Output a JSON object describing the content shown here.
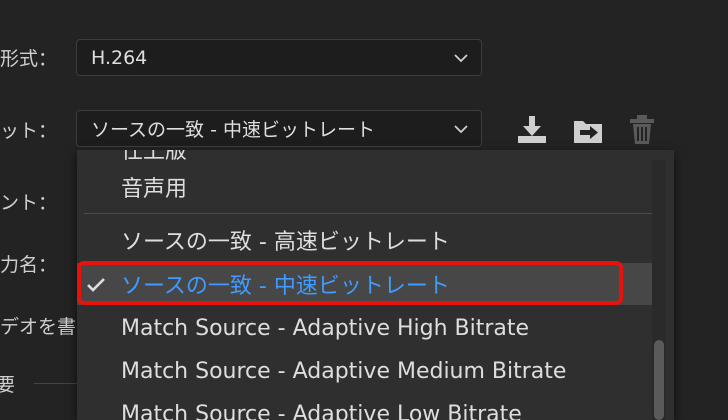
{
  "form": {
    "format": {
      "label": "形式：",
      "value": "H.264"
    },
    "preset": {
      "label": "ット：",
      "value": "ソースの一致 - 中速ビットレート"
    },
    "comment": {
      "label": "ント："
    },
    "output_name": {
      "label": "力名："
    },
    "video_export": {
      "label": "デオを書き"
    },
    "summary": {
      "label": "要"
    }
  },
  "preset_toolbar": {
    "icons": [
      "save-preset-icon",
      "import-preset-icon",
      "delete-preset-icon"
    ]
  },
  "dropdown": {
    "items": [
      {
        "label": "仕上版"
      },
      {
        "label": "音声用"
      },
      {
        "label": "ソースの一致 - 高速ビットレート"
      },
      {
        "label": "ソースの一致 - 中速ビットレート",
        "selected": true
      },
      {
        "label": "Match Source - Adaptive High Bitrate"
      },
      {
        "label": "Match Source - Adaptive Medium Bitrate"
      },
      {
        "label": "Match Source - Adaptive Low Bitrate"
      }
    ]
  },
  "colors": {
    "background": "#232323",
    "dropdown_bg": "#2f2f2f",
    "selected_text": "#3e9bff",
    "highlight_border": "#e8120c"
  }
}
